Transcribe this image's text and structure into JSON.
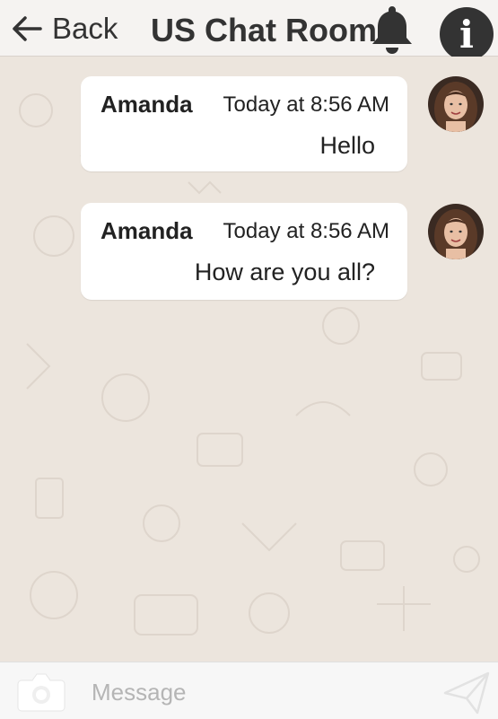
{
  "header": {
    "back_label": "Back",
    "title": "US Chat Room",
    "icons": {
      "back": "arrow-left-icon",
      "notifications": "bell-icon",
      "info": "info-icon",
      "info_glyph": "i"
    }
  },
  "messages": [
    {
      "author": "Amanda",
      "time": "Today at 8:56 AM",
      "text": "Hello"
    },
    {
      "author": "Amanda",
      "time": "Today at 8:56 AM",
      "text": "How are you all?"
    }
  ],
  "composer": {
    "placeholder": "Message",
    "value": "",
    "icons": {
      "attach": "camera-icon",
      "send": "send-icon"
    }
  },
  "colors": {
    "chat_background": "#ece5dd",
    "bubble": "#ffffff",
    "header_background": "#f5f3f1",
    "text": "#333333"
  }
}
